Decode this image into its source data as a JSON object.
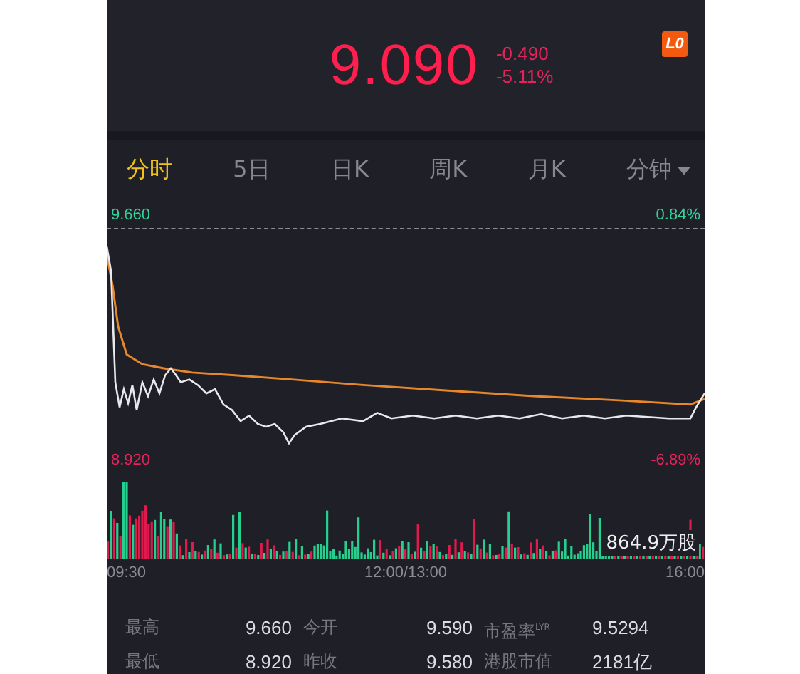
{
  "quote": {
    "price": "9.090",
    "change": "-0.490",
    "change_percent": "-5.11%",
    "badge": "L0"
  },
  "tabs": [
    {
      "label": "分时",
      "selected": true,
      "kind": "plain"
    },
    {
      "label": "5日",
      "selected": false,
      "kind": "plain"
    },
    {
      "label": "日K",
      "selected": false,
      "kind": "plain"
    },
    {
      "label": "周K",
      "selected": false,
      "kind": "plain"
    },
    {
      "label": "月K",
      "selected": false,
      "kind": "plain"
    },
    {
      "label": "分钟",
      "selected": false,
      "kind": "dropdown"
    }
  ],
  "chart": {
    "high_price": "9.660",
    "high_percent": "0.84%",
    "low_price": "8.920",
    "low_percent": "-6.89%",
    "volume": "864.9万股",
    "times": [
      "09:30",
      "12:00/13:00",
      "16:00"
    ]
  },
  "stats": [
    [
      {
        "label": "最高",
        "value": "9.660"
      },
      {
        "label": "今开",
        "value": "9.590"
      },
      {
        "label": "市盈率$^{LYR}$",
        "value": "9.5294"
      }
    ],
    [
      {
        "label": "最低",
        "value": "8.920"
      },
      {
        "label": "昨收",
        "value": "9.580"
      },
      {
        "label": "港股市值",
        "value": "2181亿"
      }
    ]
  ]
}
